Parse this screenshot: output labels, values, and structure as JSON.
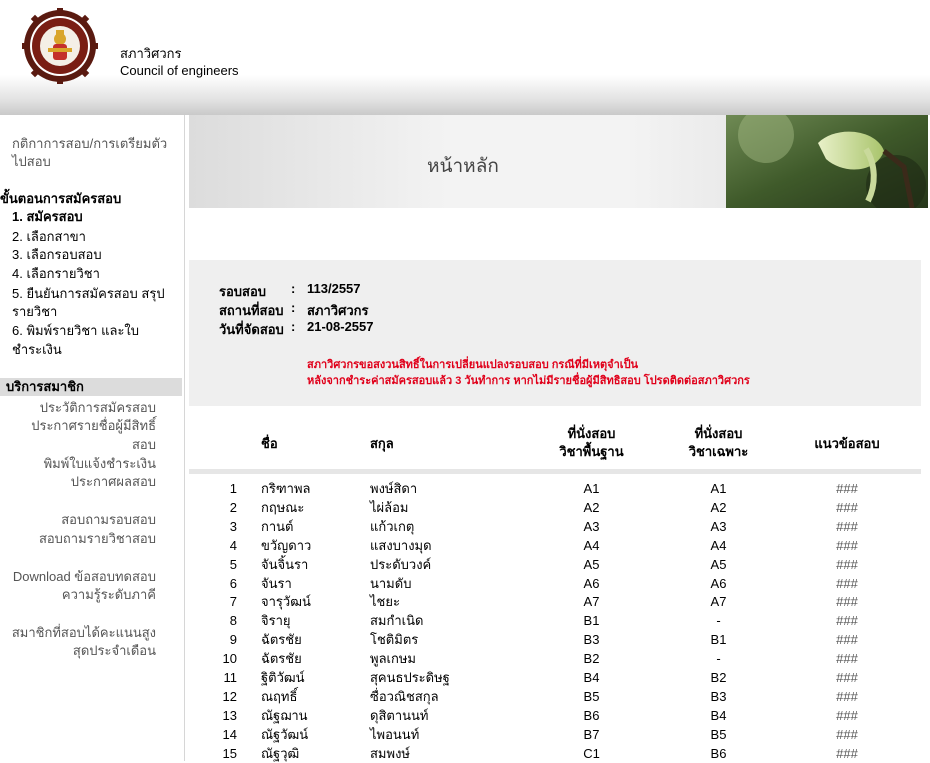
{
  "header": {
    "org_name_th": "สภาวิศวกร",
    "org_name_en": "Council of engineers"
  },
  "sidebar": {
    "rules_link": [
      "กติกาการสอบ/การเตรียมตัว",
      "ไปสอบ"
    ],
    "steps_title": "ขั้นตอนการสมัครสอบ",
    "steps": [
      "1. สมัครสอบ",
      "2. เลือกสาขา",
      "3. เลือกรอบสอบ",
      "4. เลือกรายวิชา",
      "5. ยืนยันการสมัครสอบ   สรุป",
      "รายวิชา",
      "6. พิมพ์รายวิชา   และใบ",
      "ชำระเงิน"
    ],
    "member_title": "บริการสมาชิก",
    "member_links": [
      "ประวัติการสมัครสอบ",
      "ประกาศรายชื่อผู้มีสิทธิ์",
      "สอบ",
      "พิมพ์ใบแจ้งชำระเงิน",
      "ประกาศผลสอบ",
      "สอบถามรอบสอบ",
      "สอบถามรายวิชาสอบ",
      "Download ข้อสอบทดสอบ",
      "ความรู้ระดับภาคี",
      "สมาชิกที่สอบได้คะแนนสูง",
      "สุดประจำเดือน"
    ]
  },
  "banner": {
    "title": "หน้าหลัก"
  },
  "exam_info": {
    "round_label": "รอบสอบ",
    "round_value": "113/2557",
    "venue_label": "สถานที่สอบ",
    "venue_value": "สภาวิศวกร",
    "date_label": "วันที่จัดสอบ",
    "date_value": "21-08-2557",
    "colon": ":",
    "notice_line1": "สภาวิศวกรขอสงวนสิทธิ์ในการเปลี่ยนแปลงรอบสอบ   กรณีที่มีเหตุจำเป็น",
    "notice_line2": "หลังจากชำระค่าสมัครสอบแล้ว 3 วันทำการ   หากไม่มีรายชื่อผู้มีสิทธิสอบ   โปรดติดต่อสภาวิศวกร"
  },
  "table": {
    "headers": {
      "first_name": "ชื่อ",
      "last_name": "สกุล",
      "seat_basic": [
        "ที่นั่งสอบ",
        "วิชาพื้นฐาน"
      ],
      "seat_specific": [
        "ที่นั่งสอบ",
        "วิชาเฉพาะ"
      ],
      "guide": "แนวข้อสอบ"
    },
    "rows": [
      {
        "no": "1",
        "fn": "กริฑาพล",
        "ln": "พงษ์สิดา",
        "s1": "A1",
        "s2": "A1",
        "g": "###"
      },
      {
        "no": "2",
        "fn": "กฤษณะ",
        "ln": "ไผ่ล้อม",
        "s1": "A2",
        "s2": "A2",
        "g": "###"
      },
      {
        "no": "3",
        "fn": "กานต์",
        "ln": "แก้วเกตุ",
        "s1": "A3",
        "s2": "A3",
        "g": "###"
      },
      {
        "no": "4",
        "fn": "ขวัญดาว",
        "ln": "แสงบางมุด",
        "s1": "A4",
        "s2": "A4",
        "g": "###"
      },
      {
        "no": "5",
        "fn": "จันจิ้นรา",
        "ln": "ประดับวงค์",
        "s1": "A5",
        "s2": "A5",
        "g": "###"
      },
      {
        "no": "6",
        "fn": "จันรา",
        "ln": "นามดับ",
        "s1": "A6",
        "s2": "A6",
        "g": "###"
      },
      {
        "no": "7",
        "fn": "จารุวัฒน์",
        "ln": "ไชยะ",
        "s1": "A7",
        "s2": "A7",
        "g": "###"
      },
      {
        "no": "8",
        "fn": "จิรายุ",
        "ln": "สมกำเนิด",
        "s1": "B1",
        "s2": "-",
        "g": "###"
      },
      {
        "no": "9",
        "fn": "ฉัตรชัย",
        "ln": "โชติมิตร",
        "s1": "B3",
        "s2": "B1",
        "g": "###"
      },
      {
        "no": "10",
        "fn": "ฉัตรชัย",
        "ln": "พูลเกษม",
        "s1": "B2",
        "s2": "-",
        "g": "###"
      },
      {
        "no": "11",
        "fn": "ฐิติวัฒน์",
        "ln": "สุคนธประดิษฐ",
        "s1": "B4",
        "s2": "B2",
        "g": "###"
      },
      {
        "no": "12",
        "fn": "ณฤทธิ์",
        "ln": "ซื่อวณิชสกุล",
        "s1": "B5",
        "s2": "B3",
        "g": "###"
      },
      {
        "no": "13",
        "fn": "ณัฐฌาน",
        "ln": "ดุสิตานนท์",
        "s1": "B6",
        "s2": "B4",
        "g": "###"
      },
      {
        "no": "14",
        "fn": "ณัฐวัฒน์",
        "ln": "ไพอนนท์",
        "s1": "B7",
        "s2": "B5",
        "g": "###"
      },
      {
        "no": "15",
        "fn": "ณัฐวุฒิ",
        "ln": "สมพงษ์",
        "s1": "C1",
        "s2": "B6",
        "g": "###"
      }
    ]
  },
  "colors": {
    "notice_red": "#e0001a",
    "sidebar_header_bg": "#dcdcdc"
  }
}
